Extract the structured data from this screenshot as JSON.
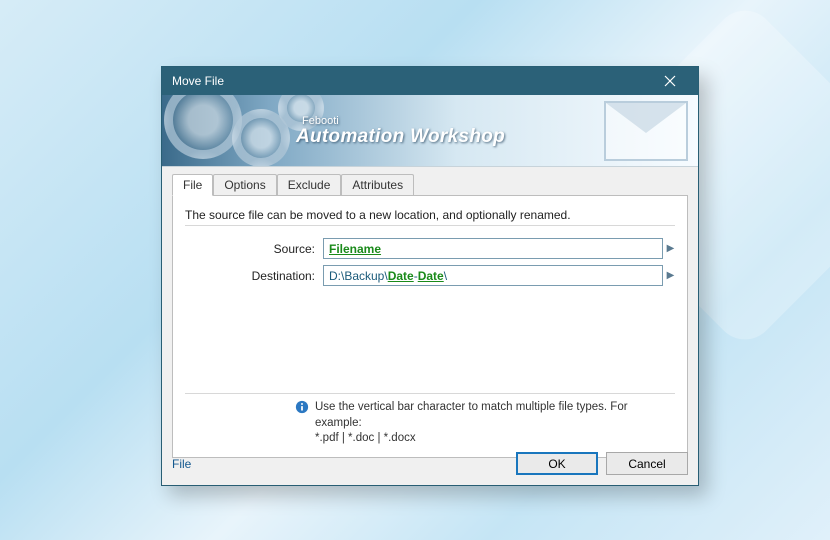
{
  "window": {
    "title": "Move File"
  },
  "banner": {
    "brand": "Febooti",
    "title": "Automation Workshop"
  },
  "tabs": {
    "items": [
      {
        "label": "File"
      },
      {
        "label": "Options"
      },
      {
        "label": "Exclude"
      },
      {
        "label": "Attributes"
      }
    ]
  },
  "panel": {
    "description": "The source file can be moved to a new location, and optionally renamed.",
    "source": {
      "label": "Source:",
      "value_var": "Filename"
    },
    "destination": {
      "label": "Destination:",
      "prefix": "D:\\Backup\\",
      "var1": "Date",
      "sep": "-",
      "var2": "Date",
      "suffix": "\\"
    },
    "hint": {
      "line1": "Use the vertical bar character to match multiple file types. For example:",
      "line2": "*.pdf | *.doc | *.docx"
    }
  },
  "footer": {
    "help_link": "File",
    "ok": "OK",
    "cancel": "Cancel"
  }
}
